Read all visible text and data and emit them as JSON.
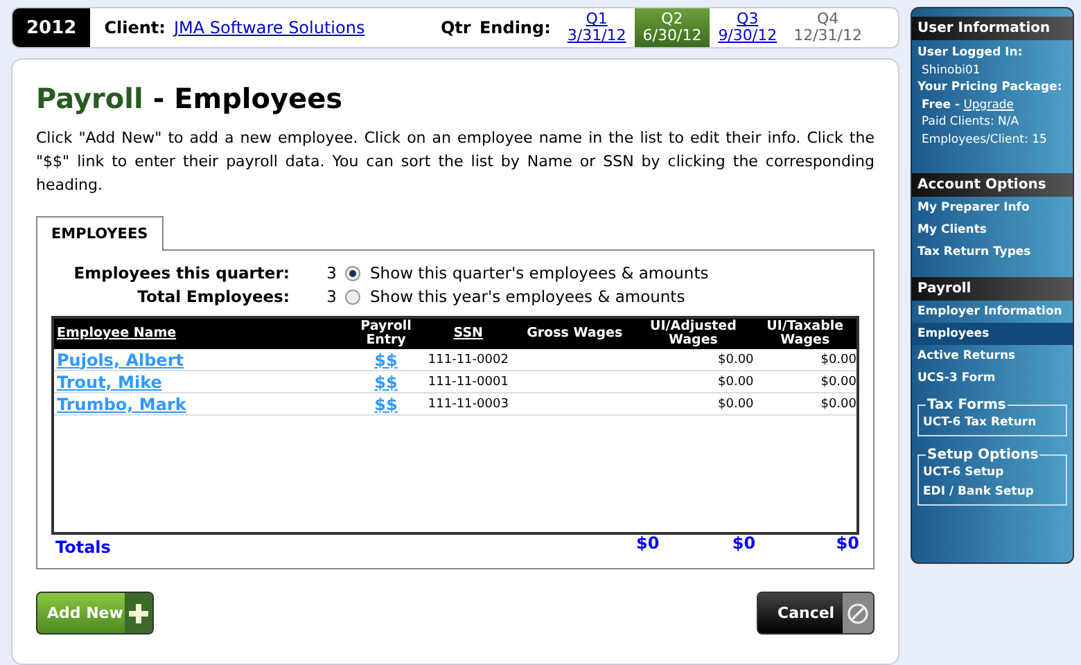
{
  "top_bar": {
    "year": "2012",
    "client_label": "Client:",
    "client": "JMA Software Solutions",
    "qtr_label": "Qtr Ending:",
    "quarters": [
      {
        "label": "Q1",
        "date": "3/31/12",
        "selected": false,
        "disabled": false
      },
      {
        "label": "Q2",
        "date": "6/30/12",
        "selected": true,
        "disabled": false
      },
      {
        "label": "Q3",
        "date": "9/30/12",
        "selected": false,
        "disabled": false
      },
      {
        "label": "Q4",
        "date": "12/31/12",
        "selected": false,
        "disabled": true
      }
    ]
  },
  "heading": {
    "section": "Payroll",
    "separator": "-",
    "page": "Employees"
  },
  "intro": "Click \"Add New\" to add a new employee. Click on an employee name in the list to edit their info. Click the \"$$\" link to enter their payroll data. You can sort the list by Name or SSN by clicking the corresponding heading.",
  "tabs": [
    {
      "label": "EMPLOYEES",
      "selected": true
    }
  ],
  "counts": [
    {
      "label": "Employees this quarter:",
      "value": "3",
      "option": "Show this quarter's employees & amounts",
      "selected": true
    },
    {
      "label": "Total Employees:",
      "value": "3",
      "option": "Show this year's employees & amounts",
      "selected": false
    }
  ],
  "table": {
    "columns": [
      {
        "label": "Employee Name",
        "sortable": true
      },
      {
        "label": "Payroll Entry",
        "sortable": false
      },
      {
        "label": "SSN",
        "sortable": true
      },
      {
        "label": "Gross Wages",
        "sortable": false
      },
      {
        "label": "UI/Adjusted Wages",
        "sortable": false
      },
      {
        "label": "UI/Taxable Wages",
        "sortable": false
      }
    ],
    "rows": [
      {
        "name": "Pujols, Albert",
        "payroll": "$$",
        "ssn": "111-11-0002",
        "adjusted": "$0.00",
        "taxable": "$0.00"
      },
      {
        "name": "Trout, Mike",
        "payroll": "$$",
        "ssn": "111-11-0001",
        "adjusted": "$0.00",
        "taxable": "$0.00"
      },
      {
        "name": "Trumbo, Mark",
        "payroll": "$$",
        "ssn": "111-11-0003",
        "adjusted": "$0.00",
        "taxable": "$0.00"
      }
    ],
    "totals": {
      "label": "Totals",
      "gross": "$0",
      "adjusted": "$0",
      "taxable": "$0"
    }
  },
  "buttons": {
    "add": "Add New",
    "cancel": "Cancel"
  },
  "sidebar": {
    "user_title": "User Information",
    "logged_in_label": "User Logged In:",
    "username": "Shinobi01",
    "package_label": "Your Pricing Package:",
    "package": "Free -",
    "upgrade": "Upgrade",
    "paid_clients": "Paid Clients: N/A",
    "employees_per_client": "Employees/Client: 15",
    "sections": [
      {
        "kind": "header",
        "title": "Account Options",
        "items": [
          {
            "label": "My Preparer Info",
            "selected": false
          },
          {
            "label": "My Clients",
            "selected": false
          },
          {
            "label": "Tax Return Types",
            "selected": false
          }
        ]
      },
      {
        "kind": "header",
        "title": "Payroll",
        "items": [
          {
            "label": "Employer Information",
            "selected": false
          },
          {
            "label": "Employees",
            "selected": true
          },
          {
            "label": "Active Returns",
            "selected": false
          },
          {
            "label": "UCS-3 Form",
            "selected": false
          }
        ]
      },
      {
        "kind": "fieldset",
        "title": "Tax Forms",
        "items": [
          {
            "label": "UCT-6 Tax Return",
            "selected": false
          }
        ]
      },
      {
        "kind": "fieldset",
        "title": "Setup Options",
        "items": [
          {
            "label": "UCT-6 Setup",
            "selected": false
          },
          {
            "label": "EDI / Bank Setup",
            "selected": false
          }
        ]
      }
    ]
  }
}
